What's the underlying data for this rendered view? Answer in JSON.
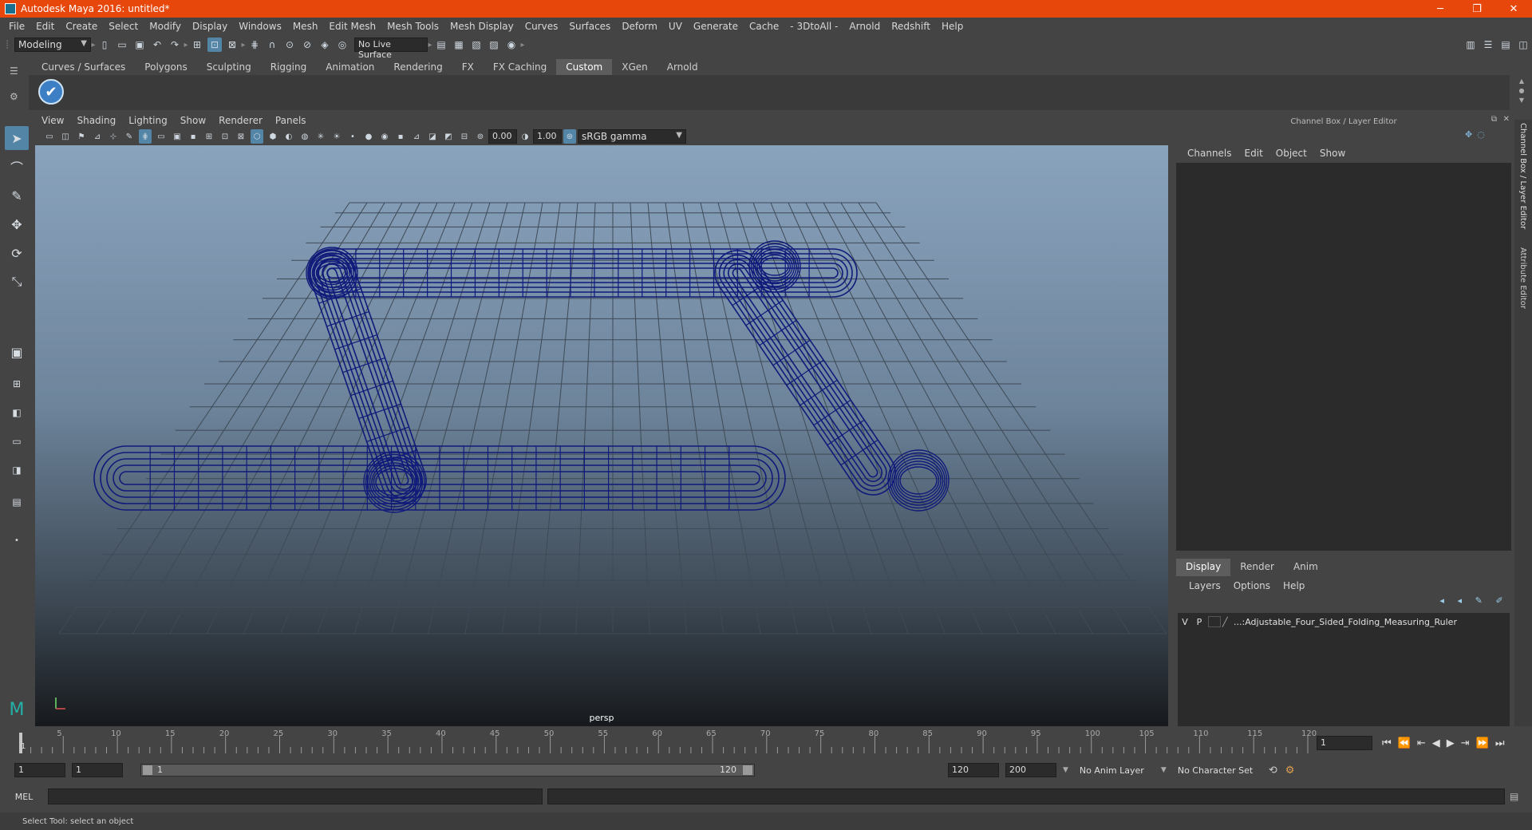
{
  "window": {
    "title": "Autodesk Maya 2016: untitled*",
    "controls": [
      "─",
      "❐",
      "✕"
    ]
  },
  "menubar": [
    "File",
    "Edit",
    "Create",
    "Select",
    "Modify",
    "Display",
    "Windows",
    "Mesh",
    "Edit Mesh",
    "Mesh Tools",
    "Mesh Display",
    "Curves",
    "Surfaces",
    "Deform",
    "UV",
    "Generate",
    "Cache",
    "- 3DtoAll -",
    "Arnold",
    "Redshift",
    "Help"
  ],
  "statusline": {
    "mode": "Modeling",
    "live_surface": "No Live Surface"
  },
  "shelf": {
    "tabs": [
      "Curves / Surfaces",
      "Polygons",
      "Sculpting",
      "Rigging",
      "Animation",
      "Rendering",
      "FX",
      "FX Caching",
      "Custom",
      "XGen",
      "Arnold"
    ],
    "active_tab": "Custom"
  },
  "viewport": {
    "menu": [
      "View",
      "Shading",
      "Lighting",
      "Show",
      "Renderer",
      "Panels"
    ],
    "exposure": "0.00",
    "gamma": "1.00",
    "color_space": "sRGB gamma",
    "camera": "persp",
    "wire_color": "#101a7a",
    "grid_color": "#3e4a56"
  },
  "channel_box": {
    "header": "Channel Box / Layer Editor",
    "menu": [
      "Channels",
      "Edit",
      "Object",
      "Show"
    ]
  },
  "layer_editor": {
    "tabs": [
      "Display",
      "Render",
      "Anim"
    ],
    "active_tab": "Display",
    "menu": [
      "Layers",
      "Options",
      "Help"
    ],
    "layer": {
      "v": "V",
      "p": "P",
      "name": "...:Adjustable_Four_Sided_Folding_Measuring_Ruler"
    }
  },
  "side_tabs": [
    "Channel Box / Layer Editor",
    "Attribute Editor"
  ],
  "timeline": {
    "ticks": [
      5,
      10,
      15,
      20,
      25,
      30,
      35,
      40,
      45,
      50,
      55,
      60,
      65,
      70,
      75,
      80,
      85,
      90,
      95,
      100,
      105,
      110,
      115,
      120
    ],
    "current_frame_label": "1",
    "current_frame": "1"
  },
  "range": {
    "start": "1",
    "playback_start": "1",
    "slider_start": "1",
    "slider_end": "120",
    "playback_end": "120",
    "end": "200",
    "anim_layer": "No Anim Layer",
    "character_set": "No Character Set"
  },
  "command": {
    "label": "MEL"
  },
  "help_line": "Select Tool: select an object"
}
